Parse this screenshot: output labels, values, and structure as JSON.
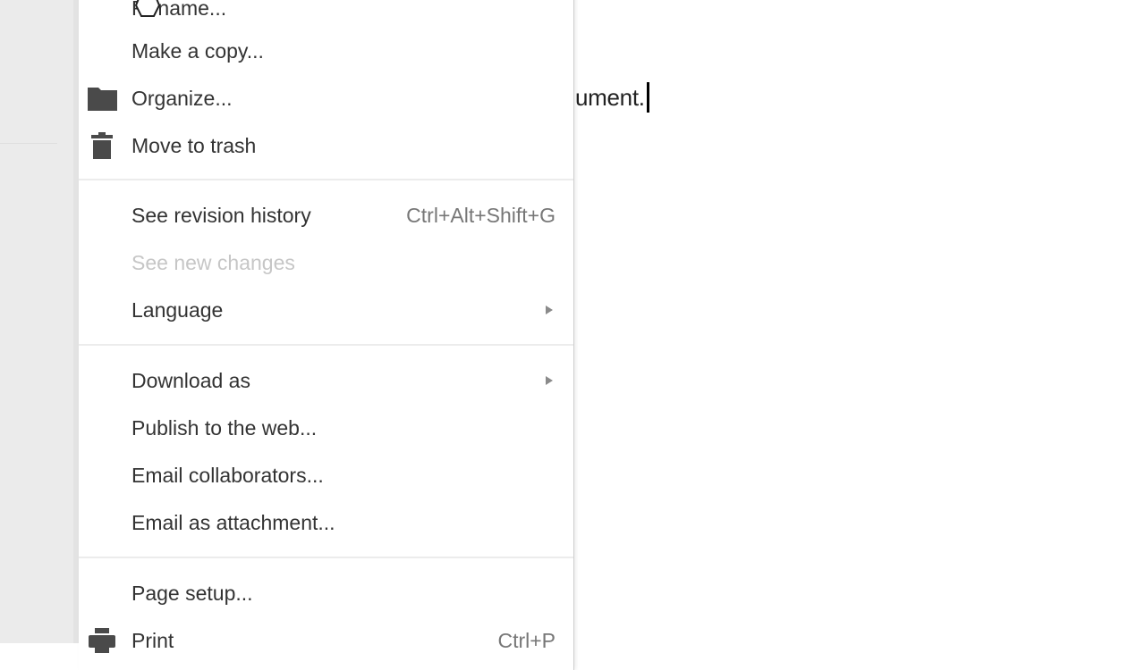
{
  "document": {
    "visible_text": "ument."
  },
  "file_menu": {
    "items": [
      {
        "label": "Rename...",
        "icon": "",
        "shortcut": "",
        "submenu": false,
        "disabled": false
      },
      {
        "label": "Make a copy...",
        "icon": "",
        "shortcut": "",
        "submenu": false,
        "disabled": false
      },
      {
        "label": "Organize...",
        "icon": "folder-icon",
        "shortcut": "",
        "submenu": false,
        "disabled": false
      },
      {
        "label": "Move to trash",
        "icon": "trash-icon",
        "shortcut": "",
        "submenu": false,
        "disabled": false
      },
      {
        "label": "See revision history",
        "icon": "",
        "shortcut": "Ctrl+Alt+Shift+G",
        "submenu": false,
        "disabled": false
      },
      {
        "label": "See new changes",
        "icon": "",
        "shortcut": "",
        "submenu": false,
        "disabled": true
      },
      {
        "label": "Language",
        "icon": "",
        "shortcut": "",
        "submenu": true,
        "disabled": false
      },
      {
        "label": "Download as",
        "icon": "",
        "shortcut": "",
        "submenu": true,
        "disabled": false
      },
      {
        "label": "Publish to the web...",
        "icon": "",
        "shortcut": "",
        "submenu": false,
        "disabled": false
      },
      {
        "label": "Email collaborators...",
        "icon": "",
        "shortcut": "",
        "submenu": false,
        "disabled": false
      },
      {
        "label": "Email as attachment...",
        "icon": "",
        "shortcut": "",
        "submenu": false,
        "disabled": false
      },
      {
        "label": "Page setup...",
        "icon": "",
        "shortcut": "",
        "submenu": false,
        "disabled": false
      },
      {
        "label": "Print",
        "icon": "print-icon",
        "shortcut": "Ctrl+P",
        "submenu": false,
        "disabled": false
      }
    ]
  },
  "colors": {
    "menu_text": "#333333",
    "disabled_text": "#c6c6c6",
    "shortcut_text": "#777777",
    "sidebar_bg": "#ebebeb"
  }
}
